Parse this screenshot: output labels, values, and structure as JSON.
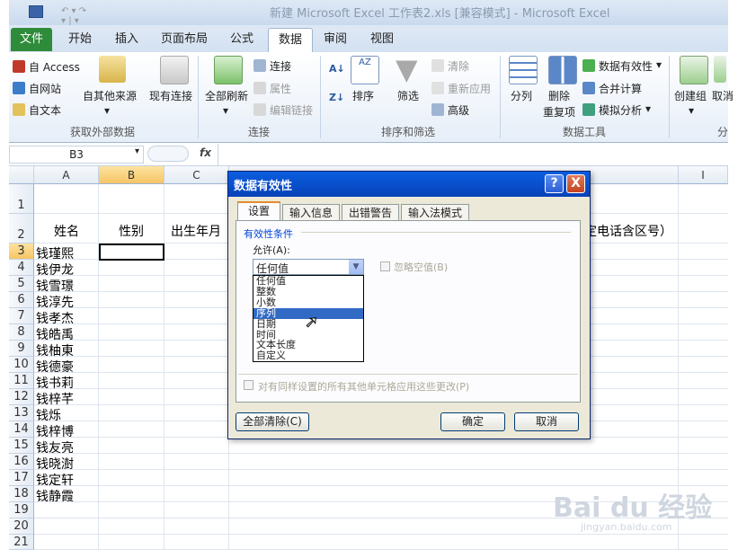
{
  "window": {
    "title": "新建 Microsoft Excel 工作表2.xls [兼容模式] - Microsoft Excel"
  },
  "tabs": [
    "文件",
    "开始",
    "插入",
    "页面布局",
    "公式",
    "数据",
    "审阅",
    "视图"
  ],
  "ribbon": {
    "ext": {
      "access": "自 Access",
      "web": "自网站",
      "text": "自文本",
      "other": "自其他来源",
      "existing": "现有连接",
      "group": "获取外部数据"
    },
    "conn": {
      "refresh": "全部刷新",
      "connections": "连接",
      "properties": "属性",
      "edit_links": "编辑链接",
      "group": "连接"
    },
    "sort": {
      "sort": "排序",
      "filter": "筛选",
      "clear": "清除",
      "reapply": "重新应用",
      "advanced": "高级",
      "group": "排序和筛选"
    },
    "tools": {
      "split": "分列",
      "remove": "删除",
      "remove2": "重复项",
      "validation": "数据有效性",
      "consolidate": "合并计算",
      "whatif": "模拟分析",
      "group": "数据工具"
    },
    "outline": {
      "group_btn": "创建组",
      "ungroup": "取消",
      "group": "分"
    }
  },
  "formula_bar": {
    "name_box": "B3",
    "fx": "fx"
  },
  "columns": [
    "A",
    "B",
    "C",
    "I"
  ],
  "rows": [
    "1",
    "2",
    "3",
    "4",
    "5",
    "6",
    "7",
    "8",
    "9",
    "10",
    "11",
    "12",
    "13",
    "14",
    "15",
    "16",
    "17",
    "18",
    "19",
    "20",
    "21"
  ],
  "headers": {
    "name": "姓名",
    "gender": "性别",
    "birth": "出生年月",
    "phone": "定电话含区号）"
  },
  "names": [
    "钱瑾熙",
    "钱伊龙",
    "钱雪璟",
    "钱淳先",
    "钱孝杰",
    "钱皓禹",
    "钱柚東",
    "钱德豪",
    "钱书莉",
    "钱梓芊",
    "钱烁",
    "钱梓博",
    "钱友亮",
    "钱晓澍",
    "钱定轩",
    "钱静霞"
  ],
  "dialog": {
    "title": "数据有效性",
    "help": "?",
    "close": "X",
    "tabs": [
      "设置",
      "输入信息",
      "出错警告",
      "输入法模式"
    ],
    "section": "有效性条件",
    "allow_label": "允许(A):",
    "allow_value": "任何值",
    "ignore_blank": "忽略空值(B)",
    "options": [
      "任何值",
      "整数",
      "小数",
      "序列",
      "日期",
      "时间",
      "文本长度",
      "自定义"
    ],
    "apply_all": "对有同样设置的所有其他单元格应用这些更改(P)",
    "clear_all": "全部清除(C)",
    "ok": "确定",
    "cancel": "取消"
  },
  "watermark": {
    "logo": "Bai du 经验",
    "url": "jingyan.baidu.com"
  }
}
